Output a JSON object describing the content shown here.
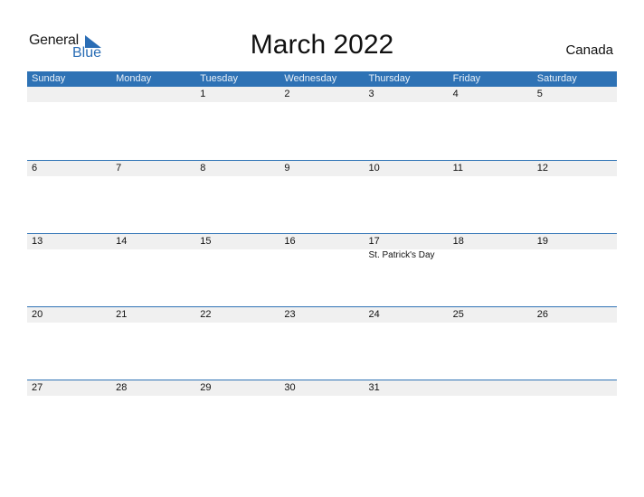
{
  "logo": {
    "general": "General",
    "blue": "Blue"
  },
  "title": "March 2022",
  "country": "Canada",
  "weekdays": [
    "Sunday",
    "Monday",
    "Tuesday",
    "Wednesday",
    "Thursday",
    "Friday",
    "Saturday"
  ],
  "weeks": [
    {
      "days": [
        "",
        "",
        "1",
        "2",
        "3",
        "4",
        "5"
      ],
      "events": [
        "",
        "",
        "",
        "",
        "",
        "",
        ""
      ]
    },
    {
      "days": [
        "6",
        "7",
        "8",
        "9",
        "10",
        "11",
        "12"
      ],
      "events": [
        "",
        "",
        "",
        "",
        "",
        "",
        ""
      ]
    },
    {
      "days": [
        "13",
        "14",
        "15",
        "16",
        "17",
        "18",
        "19"
      ],
      "events": [
        "",
        "",
        "",
        "",
        "St. Patrick's Day",
        "",
        ""
      ]
    },
    {
      "days": [
        "20",
        "21",
        "22",
        "23",
        "24",
        "25",
        "26"
      ],
      "events": [
        "",
        "",
        "",
        "",
        "",
        "",
        ""
      ]
    },
    {
      "days": [
        "27",
        "28",
        "29",
        "30",
        "31",
        "",
        ""
      ],
      "events": [
        "",
        "",
        "",
        "",
        "",
        "",
        ""
      ]
    }
  ],
  "colors": {
    "accent": "#2e72b5",
    "strip": "#f0f0f0"
  }
}
